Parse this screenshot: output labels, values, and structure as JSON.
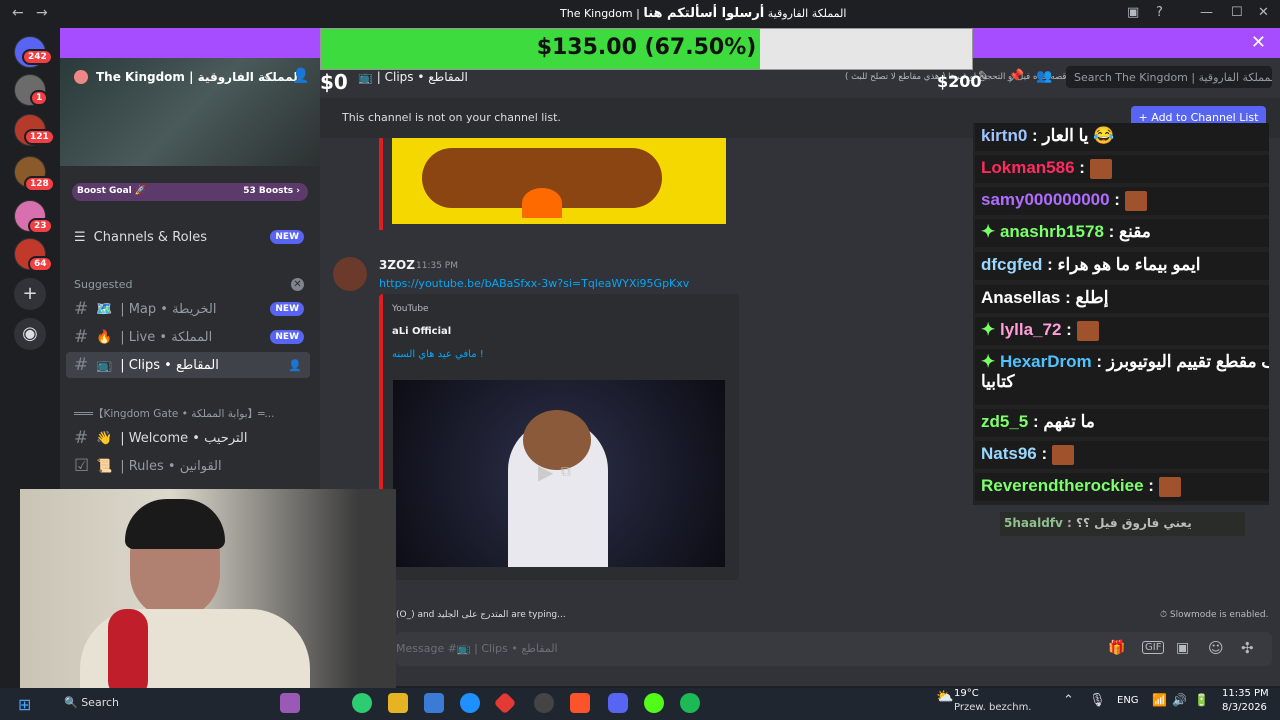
{
  "window": {
    "title": "The Kingdom | المملكة الفاروقية",
    "overlay_title": "أرسلوا أسألتكم هنا"
  },
  "banner": {
    "close": "✕"
  },
  "donation": {
    "amount_text": "$135.00 (67.50%)",
    "progress": 0.675,
    "min": "$0",
    "max": "$200"
  },
  "rail": {
    "badges": [
      "242",
      "1",
      "121",
      "128",
      "23",
      "64"
    ],
    "add_icon": "+",
    "discover_icon": "◉"
  },
  "sidebar": {
    "server_name": "The Kingdom | المملكة الفاروقية",
    "boost_goal": "Boost Goal 🚀",
    "boosts": "53 Boosts ›",
    "channels_roles": "Channels & Roles",
    "new": "NEW",
    "suggested": "Suggested",
    "suggested_items": [
      {
        "icon": "🗺️",
        "label": "| Map • الخريطة",
        "tag": "NEW"
      },
      {
        "icon": "🔥",
        "label": "| Live • المملكة",
        "tag": "NEW"
      },
      {
        "icon": "📺",
        "label": "| Clips • المقاطع",
        "tag": ""
      }
    ],
    "category": "═══【Kingdom Gate • بوابة المملكة】═...",
    "channels": [
      {
        "icon": "👋",
        "label": "| Welcome • الترحيب"
      },
      {
        "icon": "📜",
        "label": "| Rules • القوانين"
      }
    ]
  },
  "header": {
    "channel": "📺 | Clips • المقاطع",
    "topic": "دقائق نوعا ما 3 - اي مقطع وثائقي او مقطع تافه مثل قصه حياه فيل او التحجيج او غيرها ( هذي مقاطع لا تصلح للبث )",
    "search_placeholder": "Search The Kingdom | المملكة الفاروقية"
  },
  "notice": {
    "text": "This channel is not on your channel list.",
    "add_button": "+ Add to Channel List"
  },
  "message": {
    "author": "3ZOZ",
    "time": "11:35 PM",
    "link": "https://youtube.be/bABaSfxx-3w?si=TqleaWYXi95GpKxv",
    "embed_provider": "YouTube",
    "embed_author": "aLi Official",
    "embed_title": "مافي عيد هاي السنه !"
  },
  "typing": {
    "text": "(O_) and المتدرج على الجليد are typing...",
    "slowmode": "Slowmode is enabled."
  },
  "composer": {
    "placeholder": "Message #📺 | Clips • المقاطع"
  },
  "overlay_chat": [
    {
      "user": "kirtn0",
      "color": "#a0c4ff",
      "msg": "يا العار 😂",
      "emote": false,
      "badge": false
    },
    {
      "user": "Lokman586",
      "color": "#ff2a5f",
      "msg": "",
      "emote": true,
      "badge": false
    },
    {
      "user": "samy000000000",
      "color": "#b06cff",
      "msg": "",
      "emote": true,
      "badge": false
    },
    {
      "user": "anashrb1578",
      "color": "#7cff6b",
      "msg": "مقنع",
      "emote": false,
      "badge": true
    },
    {
      "user": "dfcgfed",
      "color": "#9ad7ff",
      "msg": "ايمو بيماء ما هو هراء",
      "emote": false,
      "badge": false
    },
    {
      "user": "Anasellas",
      "color": "#ffffff",
      "msg": "إطلع",
      "emote": false,
      "badge": false
    },
    {
      "user": "lylla_72",
      "color": "#ff9ed8",
      "msg": "",
      "emote": true,
      "badge": true
    },
    {
      "user": "HexarDrom",
      "color": "#4fc3ff",
      "msg": "شوف مقطع تقييم اليوتيوبرز",
      "emote": false,
      "badge": true,
      "msg2": "كتابيا"
    },
    {
      "user": "zd5_5",
      "color": "#7cff6b",
      "msg": "ما تفهم",
      "emote": false,
      "badge": false
    },
    {
      "user": "Nats96",
      "color": "#9ad7ff",
      "msg": "",
      "emote": true,
      "badge": false
    },
    {
      "user": "Reverendtherockiee",
      "color": "#7cff6b",
      "msg": "",
      "emote": true,
      "badge": false
    }
  ],
  "overlay_last": {
    "user": "5haaldfv",
    "msg": "يعني فاروق فيل ؟؟"
  },
  "taskbar": {
    "search": "Search",
    "weather_temp": "19°C",
    "weather_desc": "Przew. bezchm.",
    "lang": "ENG",
    "time": "11:35 PM",
    "date": "8/3/2026"
  }
}
